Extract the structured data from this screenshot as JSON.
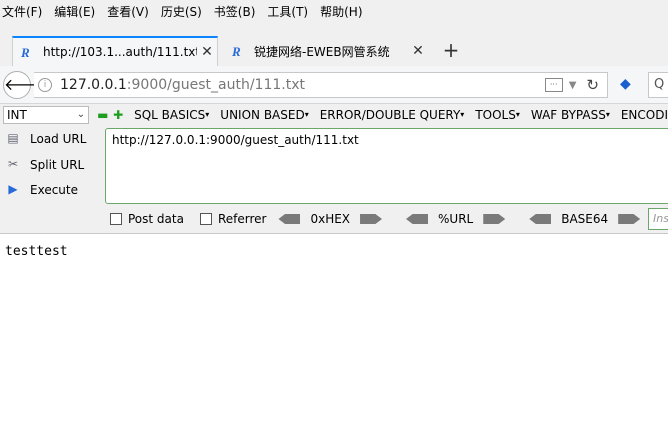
{
  "menu": [
    "文件(F)",
    "编辑(E)",
    "查看(V)",
    "历史(S)",
    "书签(B)",
    "工具(T)",
    "帮助(H)"
  ],
  "tabs": [
    {
      "label": "http://103.1...auth/111.txt",
      "close": "✕",
      "icon": "R"
    },
    {
      "label": "锐捷网络-EWEB网管系统",
      "close": "✕",
      "icon": "R"
    }
  ],
  "new_tab": "+",
  "nav": {
    "back": "🡐",
    "url_host": "127.0.0.1",
    "url_rest": ":9000/guest_auth/111.txt",
    "info": "i",
    "reload": "↻",
    "search": "Q"
  },
  "hackbar": {
    "select_value": "INT",
    "menus": [
      "SQL BASICS",
      "UNION BASED",
      "ERROR/DOUBLE QUERY",
      "TOOLS",
      "WAF BYPASS",
      "ENCODI"
    ],
    "actions": [
      "Load URL",
      "Split URL",
      "Execute"
    ],
    "textarea": "http://127.0.0.1:9000/guest_auth/111.txt",
    "post_data": "Post data",
    "referrer": "Referrer",
    "encoders": [
      "0xHEX",
      "%URL",
      "BASE64"
    ],
    "inspect_placeholder": "Ins"
  },
  "page_content": "testtest",
  "colors": {
    "accent": "#0a84ff",
    "hackbar_border": "#6aa86a",
    "plus_minus": "#1e9e1e"
  }
}
